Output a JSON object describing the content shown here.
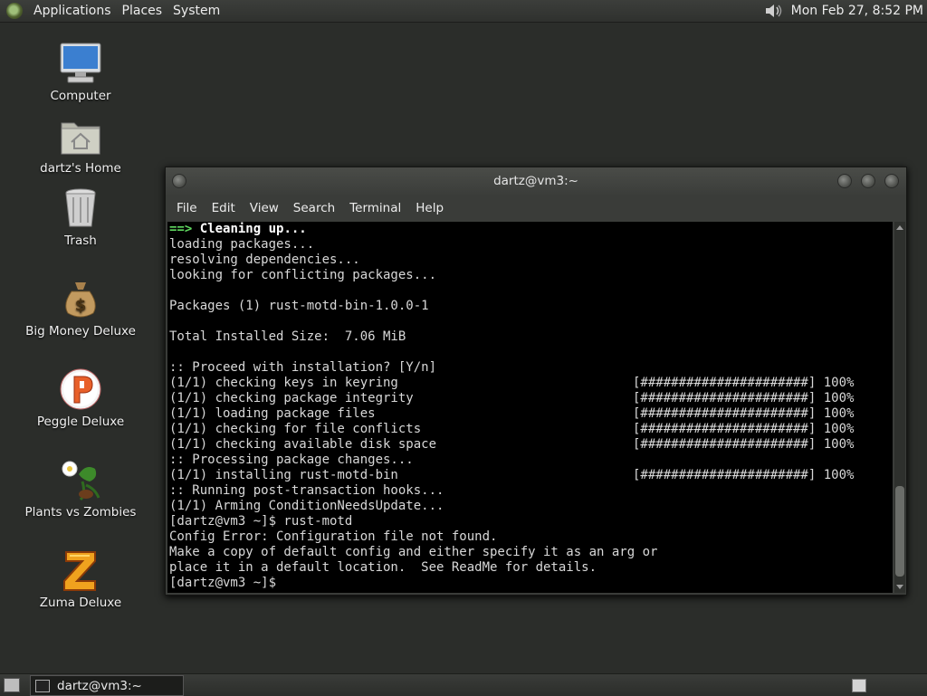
{
  "top_panel": {
    "menus": [
      "Applications",
      "Places",
      "System"
    ],
    "clock": "Mon Feb 27,  8:52 PM"
  },
  "desktop_icons": [
    {
      "label": "Computer"
    },
    {
      "label": "dartz's Home"
    },
    {
      "label": "Trash"
    },
    {
      "label": "Big Money Deluxe"
    },
    {
      "label": "Peggle Deluxe"
    },
    {
      "label": "Plants vs Zombies"
    },
    {
      "label": "Zuma Deluxe"
    }
  ],
  "terminal": {
    "title": "dartz@vm3:~",
    "menus": [
      "File",
      "Edit",
      "View",
      "Search",
      "Terminal",
      "Help"
    ],
    "first_line": {
      "arrow": "==>",
      "text": " Cleaning up..."
    },
    "lines": [
      {
        "text": "loading packages...",
        "bar": ""
      },
      {
        "text": "resolving dependencies...",
        "bar": ""
      },
      {
        "text": "looking for conflicting packages...",
        "bar": ""
      },
      {
        "text": "",
        "bar": ""
      },
      {
        "text": "Packages (1) rust-motd-bin-1.0.0-1",
        "bar": ""
      },
      {
        "text": "",
        "bar": ""
      },
      {
        "text": "Total Installed Size:  7.06 MiB",
        "bar": ""
      },
      {
        "text": "",
        "bar": ""
      },
      {
        "text": ":: Proceed with installation? [Y/n]",
        "bar": ""
      },
      {
        "text": "(1/1) checking keys in keyring",
        "bar": "[######################] 100%"
      },
      {
        "text": "(1/1) checking package integrity",
        "bar": "[######################] 100%"
      },
      {
        "text": "(1/1) loading package files",
        "bar": "[######################] 100%"
      },
      {
        "text": "(1/1) checking for file conflicts",
        "bar": "[######################] 100%"
      },
      {
        "text": "(1/1) checking available disk space",
        "bar": "[######################] 100%"
      },
      {
        "text": ":: Processing package changes...",
        "bar": ""
      },
      {
        "text": "(1/1) installing rust-motd-bin",
        "bar": "[######################] 100%"
      },
      {
        "text": ":: Running post-transaction hooks...",
        "bar": ""
      },
      {
        "text": "(1/1) Arming ConditionNeedsUpdate...",
        "bar": ""
      },
      {
        "text": "[dartz@vm3 ~]$ rust-motd",
        "bar": ""
      },
      {
        "text": "Config Error: Configuration file not found.",
        "bar": ""
      },
      {
        "text": "Make a copy of default config and either specify it as an arg or",
        "bar": ""
      },
      {
        "text": "place it in a default location.  See ReadMe for details.",
        "bar": ""
      },
      {
        "text": "[dartz@vm3 ~]$",
        "bar": ""
      }
    ]
  },
  "taskbar": {
    "task_label": "dartz@vm3:~"
  }
}
